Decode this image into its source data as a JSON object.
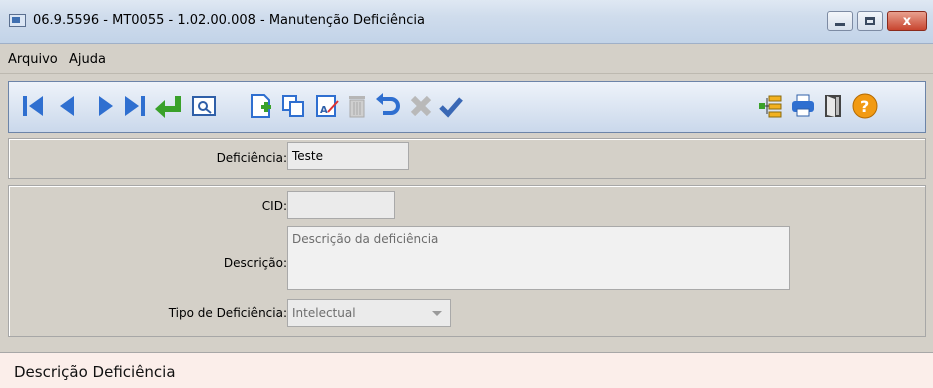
{
  "window": {
    "title": "06.9.5596 - MT0055 - 1.02.00.008 - Manutenção Deficiência",
    "close_glyph": "x"
  },
  "menu": {
    "items": [
      {
        "label": "Arquivo"
      },
      {
        "label": "Ajuda"
      }
    ]
  },
  "toolbar": {
    "buttons": [
      "first-record",
      "previous-record",
      "next-record",
      "last-record",
      "go-to",
      "search",
      "new",
      "copy",
      "edit",
      "delete",
      "undo",
      "cancel",
      "confirm",
      "tree-view",
      "print",
      "exit",
      "help"
    ]
  },
  "form": {
    "deficiencia_label": "Deficiência:",
    "deficiencia_value": "Teste",
    "cid_label": "CID:",
    "cid_value": "",
    "descricao_label": "Descrição:",
    "descricao_value": "Descrição da deficiência",
    "tipo_label": "Tipo de Deficiência:",
    "tipo_value": "Intelectual"
  },
  "status": {
    "text": "Descrição Deficiência"
  },
  "colors": {
    "accent_blue": "#2f6fd0",
    "confirm_blue": "#3a68b5",
    "help_orange": "#f29a12",
    "return_green": "#3aa12a",
    "status_bg": "#fbeeea"
  }
}
